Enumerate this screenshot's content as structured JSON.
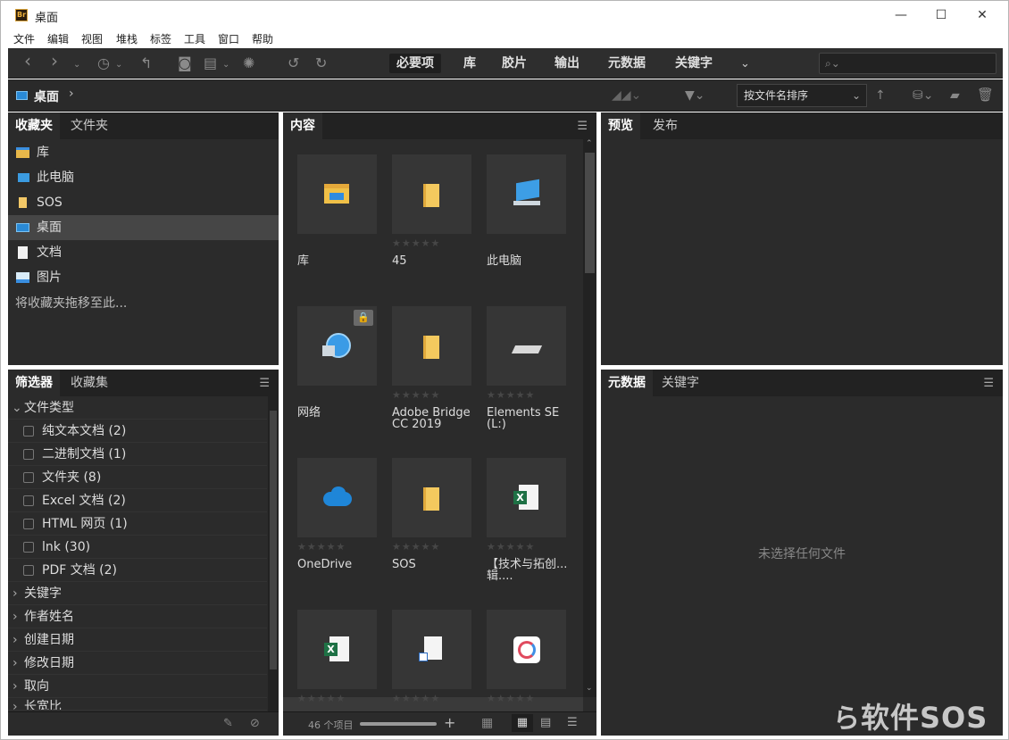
{
  "window": {
    "app_icon": "Br",
    "title": "桌面",
    "minimize": "—",
    "maximize": "☐",
    "close": "✕"
  },
  "menu": [
    "文件",
    "编辑",
    "视图",
    "堆栈",
    "标签",
    "工具",
    "窗口",
    "帮助"
  ],
  "workspaces": [
    "必要项",
    "库",
    "胶片",
    "输出",
    "元数据",
    "关键字"
  ],
  "path": {
    "current": "桌面"
  },
  "sort": {
    "label": "按文件名排序"
  },
  "panels": {
    "left_top_tabs": [
      "收藏夹",
      "文件夹"
    ],
    "favorites": [
      {
        "label": "库",
        "icon": "library-icon"
      },
      {
        "label": "此电脑",
        "icon": "computer-icon"
      },
      {
        "label": "SOS",
        "icon": "folder-icon"
      },
      {
        "label": "桌面",
        "icon": "desktop-icon"
      },
      {
        "label": "文档",
        "icon": "document-icon"
      },
      {
        "label": "图片",
        "icon": "picture-icon"
      }
    ],
    "favorites_hint": "将收藏夹拖移至此...",
    "left_bottom_tabs": [
      "筛选器",
      "收藏集"
    ],
    "filter_group": "文件类型",
    "filter_items": [
      "纯文本文档 (2)",
      "二进制文档 (1)",
      "文件夹 (8)",
      "Excel 文档 (2)",
      "HTML 网页 (1)",
      "lnk (30)",
      "PDF 文档 (2)"
    ],
    "filter_sections": [
      "关键字",
      "作者姓名",
      "创建日期",
      "修改日期",
      "取向",
      "长宽比"
    ],
    "content_tab": "内容",
    "preview_tabs": [
      "预览",
      "发布"
    ],
    "meta_tabs": [
      "元数据",
      "关键字"
    ],
    "no_selection": "未选择任何文件"
  },
  "thumbnails": [
    {
      "label": "库",
      "icon": "library-icon",
      "stars": false
    },
    {
      "label": "45",
      "icon": "folder-icon",
      "stars": true
    },
    {
      "label": "此电脑",
      "icon": "computer-icon",
      "stars": false
    },
    {
      "label": "网络",
      "icon": "network-icon",
      "stars": false
    },
    {
      "label": "Adobe Bridge CC 2019",
      "icon": "folder-icon",
      "stars": true
    },
    {
      "label": "Elements SE (L:)",
      "icon": "drive-icon",
      "stars": true
    },
    {
      "label": "OneDrive",
      "icon": "cloud-icon",
      "stars": true
    },
    {
      "label": "SOS",
      "icon": "folder-icon",
      "stars": true
    },
    {
      "label": "【技术与拓创...辑....",
      "icon": "excel-icon",
      "stars": true
    },
    {
      "label": "",
      "icon": "excel-icon",
      "stars": true
    },
    {
      "label": "",
      "icon": "shortcut-icon",
      "stars": true
    },
    {
      "label": "",
      "icon": "app-shortcut-icon",
      "stars": true
    }
  ],
  "status": {
    "count": "46 个项目"
  },
  "watermark": "软件SOS"
}
